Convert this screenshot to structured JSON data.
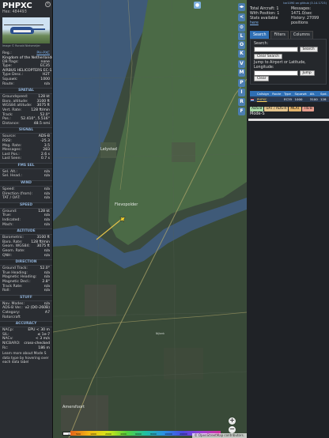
{
  "aircraft": {
    "callsign": "PHPXC",
    "hex_label": "Hex:",
    "hex": "484493",
    "image_credit": "Image © Ronald Nielsmeijer",
    "reg_label": "Reg.:",
    "reg": "PH-PXC",
    "country": "Kingdom of the Netherlands",
    "dbflags_label": "DB flags:",
    "dbflags": "none",
    "type_label": "Type:",
    "type": "EC35",
    "type_desc": "AIRBUS HELICOPTERS EC-135/635",
    "typedesc_label": "Type Desc.:",
    "typedesc": "H2T",
    "squawk_label": "Squawk:",
    "squawk": "1000",
    "route_label": "Route:",
    "route": "n/a"
  },
  "sections": {
    "spatial": "SPATIAL",
    "signal": "SIGNAL",
    "fms": "FMS SEL",
    "wind": "WIND",
    "speed": "SPEED",
    "altitude": "ALTITUDE",
    "direction": "DIRECTION",
    "stuff": "STUFF",
    "accuracy": "ACCURACY"
  },
  "spatial": [
    {
      "k": "Groundspeed:",
      "v": "128 kt"
    },
    {
      "k": "Baro. altitude:",
      "v": "3100 ft"
    },
    {
      "k": "WGS84 altitude:",
      "v": "3075 ft"
    },
    {
      "k": "Vert. Rate:",
      "v": "128 ft/min"
    },
    {
      "k": "Track:",
      "v": "52.0°"
    },
    {
      "k": "Pos.:",
      "v": "52.410°, 5.516°"
    },
    {
      "k": "Distance:",
      "v": "48.5 nmi"
    }
  ],
  "signal": [
    {
      "k": "Source:",
      "v": "ADS-B"
    },
    {
      "k": "RSSI:",
      "v": "-25.3"
    },
    {
      "k": "Msg. Rate:",
      "v": "3.5"
    },
    {
      "k": "Messages:",
      "v": "283"
    },
    {
      "k": "Last Pos.:",
      "v": "2.6 s"
    },
    {
      "k": "Last Seen:",
      "v": "0.7 s"
    }
  ],
  "fms": [
    {
      "k": "Sel. Alt.:",
      "v": "n/a"
    },
    {
      "k": "Sel. Head.:",
      "v": "n/a"
    }
  ],
  "wind": [
    {
      "k": "Speed:",
      "v": "n/a"
    },
    {
      "k": "Direction (from):",
      "v": "n/a"
    },
    {
      "k": "TAT / OAT:",
      "v": "n/a"
    }
  ],
  "speed": [
    {
      "k": "Ground:",
      "v": "128 kt"
    },
    {
      "k": "True:",
      "v": "n/a"
    },
    {
      "k": "Indicated:",
      "v": "n/a"
    },
    {
      "k": "Mach:",
      "v": "n/a"
    }
  ],
  "altitude": [
    {
      "k": "Barometric:",
      "v": "3100 ft"
    },
    {
      "k": "Baro. Rate:",
      "v": "128 ft/min"
    },
    {
      "k": "Geom. WGS84:",
      "v": "3075 ft"
    },
    {
      "k": "Geom. Rate:",
      "v": "n/a"
    },
    {
      "k": "QNH:",
      "v": "n/a"
    }
  ],
  "direction": [
    {
      "k": "Ground Track:",
      "v": "52.0°"
    },
    {
      "k": "True Heading:",
      "v": "n/a"
    },
    {
      "k": "Magnetic Heading:",
      "v": "n/a"
    },
    {
      "k": "Magnetic Decl.:",
      "v": "2.8°"
    },
    {
      "k": "Track Rate:",
      "v": "n/a"
    },
    {
      "k": "Roll:",
      "v": "n/a"
    }
  ],
  "stuff": [
    {
      "k": "Nav. Modes:",
      "v": "n/a"
    },
    {
      "k": "ADS-B Ver.:",
      "v": "v2 (DO-260B)"
    },
    {
      "k": "Category:",
      "v": "A7"
    },
    {
      "k": "Rotorcraft",
      "v": ""
    }
  ],
  "accuracy": [
    {
      "k": "NACp:",
      "v": "EPU < 30 m"
    },
    {
      "k": "SIL:",
      "v": "≤ 1e-7"
    },
    {
      "k": "NACv:",
      "v": "< 3 m/s"
    },
    {
      "k": "NICBARO:",
      "v": "cross-checked"
    },
    {
      "k": "Rc:",
      "v": "186 m"
    }
  ],
  "learn_more": "Learn more about Mode S data type by hovering over each data label",
  "map": {
    "places": {
      "lelystad": "Lelystad",
      "flevopolder": "Flevopolder",
      "amersfoort": "Amersfoort",
      "nijkerk": "Nijkerk"
    },
    "top_buttons": [
      "U",
      "H",
      "T"
    ],
    "strip_buttons": [
      "L",
      "O",
      "K",
      "V",
      "M",
      "P",
      "I",
      "R",
      "F"
    ],
    "scale": "2 km",
    "legend_ticks": [
      "500",
      "1000",
      "2000",
      "4000",
      "6000",
      "8000",
      "10000",
      "20000",
      "30000",
      "40000+"
    ],
    "attribution": "© OpenStreetMap contributors."
  },
  "right": {
    "version": "tar1090 on github (3.14.1723)",
    "total_label": "Total Aircraft:",
    "total": "1",
    "withpos_label": "With Position:",
    "withpos": "1",
    "stats_label": "Stats available",
    "stats_link": "here",
    "messages_label": "Messages:",
    "messages": "1471.0/sec",
    "history_label": "History:",
    "history": "27099 positions",
    "tabs": [
      "Search",
      "Filters",
      "Columns"
    ],
    "search_label": "Search:",
    "search_btn": "Search",
    "clear_search": "Clear Search",
    "jump_label": "Jump to Airport or Latitude, Longitude:",
    "jump_btn": "Jump",
    "clear_btn": "Clear",
    "table_headers": [
      "Callsign",
      "Route",
      "Type",
      "Squawk",
      "Alt.",
      "Spd."
    ],
    "table_rows": [
      {
        "callsign": "PHPXC",
        "route": "",
        "type": "EC35",
        "squawk": "1000",
        "alt": "3100",
        "spd": "128"
      }
    ],
    "chips": [
      {
        "label": "ADS-B",
        "color": "#a7d8a6"
      },
      {
        "label": "UAT / ADS-R",
        "color": "#e4c48c"
      },
      {
        "label": "MLAT",
        "color": "#e2b36b"
      },
      {
        "label": "TIS-B",
        "color": "#e59c8c"
      }
    ],
    "mode_s": "Mode-S"
  }
}
